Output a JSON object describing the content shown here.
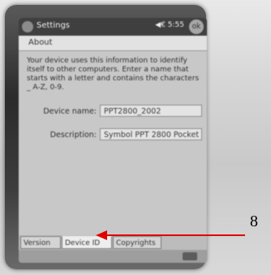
{
  "titlebar": {
    "app_title": "Settings",
    "status": "◀€ 5:55",
    "ok": "ok"
  },
  "about": {
    "header": "About",
    "description": "Your device uses this information to identify itself to other computers. Enter a name that starts with a letter and contains the characters _ A-Z, 0-9."
  },
  "fields": {
    "device_name_label": "Device name:",
    "device_name_value": "PPT2800_2002",
    "description_label": "Description:",
    "description_value": "Symbol PPT 2800 Pocket"
  },
  "tabs": [
    {
      "label": "Version"
    },
    {
      "label": "Device ID"
    },
    {
      "label": "Copyrights"
    }
  ],
  "annotation": {
    "number": "8",
    "color": "#e00000"
  }
}
